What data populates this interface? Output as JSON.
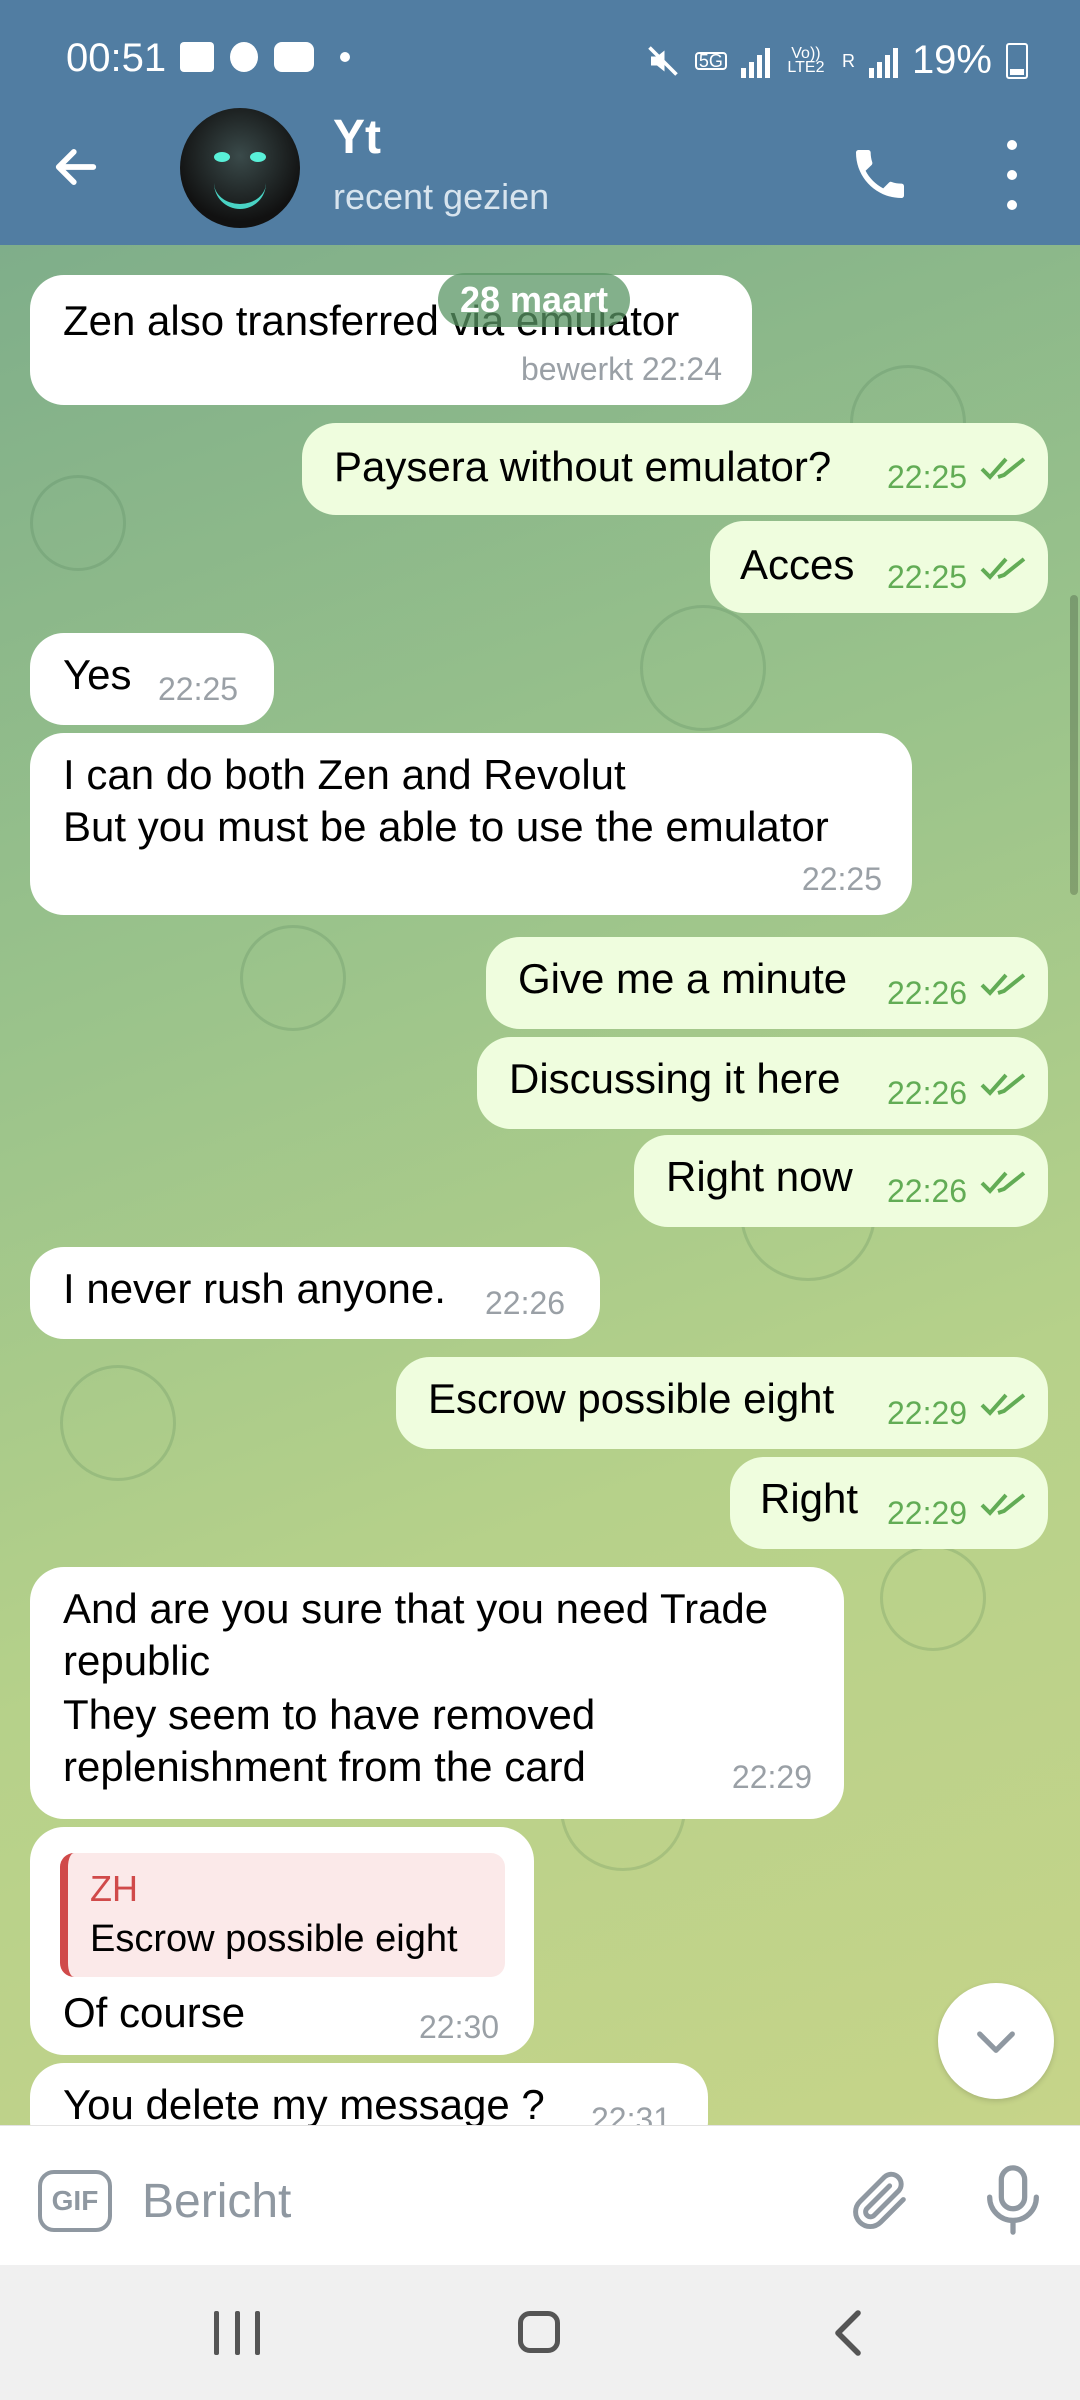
{
  "status_bar": {
    "time": "00:51",
    "network": "5G",
    "volte": "Vo)) LTE2",
    "roaming": "R",
    "battery": "19%"
  },
  "header": {
    "name": "Yt",
    "status": "recent gezien",
    "back_icon": "arrow-left-icon",
    "call_icon": "phone-icon",
    "menu_icon": "more-vertical-icon"
  },
  "date_label": "28 maart",
  "messages": [
    {
      "dir": "in",
      "text": "Zen also transferred via emulator",
      "time": "bewerkt 22:24"
    },
    {
      "dir": "out",
      "text": "Paysera without emulator?",
      "time": "22:25"
    },
    {
      "dir": "out",
      "text": "Acces",
      "time": "22:25"
    },
    {
      "dir": "in",
      "text": "Yes",
      "time": "22:25"
    },
    {
      "dir": "in",
      "lines": [
        "I can do both Zen and Revolut",
        "But you must be able to use the emulator"
      ],
      "time": "22:25"
    },
    {
      "dir": "out",
      "text": "Give me a minute",
      "time": "22:26"
    },
    {
      "dir": "out",
      "text": "Discussing it here",
      "time": "22:26"
    },
    {
      "dir": "out",
      "text": "Right now",
      "time": "22:26"
    },
    {
      "dir": "in",
      "text": "I never rush anyone.",
      "time": "22:26"
    },
    {
      "dir": "out",
      "text": "Escrow possible eight",
      "time": "22:29"
    },
    {
      "dir": "out",
      "text": "Right",
      "time": "22:29"
    },
    {
      "dir": "in",
      "lines": [
        "And are you sure that you need Trade",
        "republic",
        "They seem to have removed",
        "replenishment from the card"
      ],
      "time": "22:29"
    },
    {
      "dir": "in",
      "reply_name": "ZH",
      "reply_text": "Escrow possible eight",
      "text": "Of course",
      "time": "22:30"
    },
    {
      "dir": "in",
      "text": "You delete my message ?",
      "time": "22:31"
    }
  ],
  "input": {
    "gif_label": "GIF",
    "placeholder": "Bericht"
  },
  "colors": {
    "header": "#517da2",
    "incoming_bubble": "#ffffff",
    "outgoing_bubble": "#effdde",
    "outgoing_time": "#62ac55"
  }
}
